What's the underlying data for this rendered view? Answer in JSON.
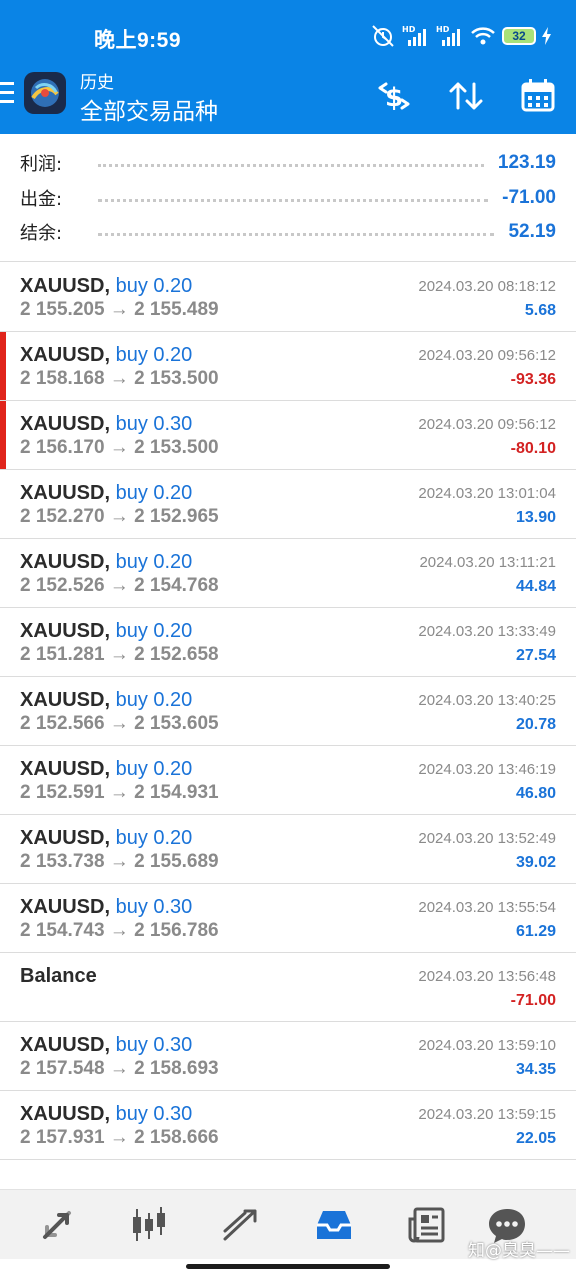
{
  "status_bar": {
    "time": "晚上9:59",
    "battery": "32"
  },
  "app_bar": {
    "title": "历史",
    "subtitle": "全部交易品种"
  },
  "summary": {
    "profit_label": "利润:",
    "profit_value": "123.19",
    "withdrawal_label": "出金:",
    "withdrawal_value": "-71.00",
    "balance_label": "结余:",
    "balance_value": "52.19"
  },
  "trades": [
    {
      "symbol": "XAUUSD,",
      "side": "buy 0.20",
      "prices": "2 155.205 → 2 155.489",
      "datetime": "2024.03.20 08:18:12",
      "profit": "5.68",
      "negative": false
    },
    {
      "symbol": "XAUUSD,",
      "side": "buy 0.20",
      "prices": "2 158.168 → 2 153.500",
      "datetime": "2024.03.20 09:56:12",
      "profit": "-93.36",
      "negative": true
    },
    {
      "symbol": "XAUUSD,",
      "side": "buy 0.30",
      "prices": "2 156.170 → 2 153.500",
      "datetime": "2024.03.20 09:56:12",
      "profit": "-80.10",
      "negative": true
    },
    {
      "symbol": "XAUUSD,",
      "side": "buy 0.20",
      "prices": "2 152.270 → 2 152.965",
      "datetime": "2024.03.20 13:01:04",
      "profit": "13.90",
      "negative": false
    },
    {
      "symbol": "XAUUSD,",
      "side": "buy 0.20",
      "prices": "2 152.526 → 2 154.768",
      "datetime": "2024.03.20 13:11:21",
      "profit": "44.84",
      "negative": false
    },
    {
      "symbol": "XAUUSD,",
      "side": "buy 0.20",
      "prices": "2 151.281 → 2 152.658",
      "datetime": "2024.03.20 13:33:49",
      "profit": "27.54",
      "negative": false
    },
    {
      "symbol": "XAUUSD,",
      "side": "buy 0.20",
      "prices": "2 152.566 → 2 153.605",
      "datetime": "2024.03.20 13:40:25",
      "profit": "20.78",
      "negative": false
    },
    {
      "symbol": "XAUUSD,",
      "side": "buy 0.20",
      "prices": "2 152.591 → 2 154.931",
      "datetime": "2024.03.20 13:46:19",
      "profit": "46.80",
      "negative": false
    },
    {
      "symbol": "XAUUSD,",
      "side": "buy 0.20",
      "prices": "2 153.738 → 2 155.689",
      "datetime": "2024.03.20 13:52:49",
      "profit": "39.02",
      "negative": false
    },
    {
      "symbol": "XAUUSD,",
      "side": "buy 0.30",
      "prices": "2 154.743 → 2 156.786",
      "datetime": "2024.03.20 13:55:54",
      "profit": "61.29",
      "negative": false
    },
    {
      "symbol": "Balance",
      "side": "",
      "prices": "",
      "datetime": "2024.03.20 13:56:48",
      "profit": "-71.00",
      "negative": true
    },
    {
      "symbol": "XAUUSD,",
      "side": "buy 0.30",
      "prices": "2 157.548 → 2 158.693",
      "datetime": "2024.03.20 13:59:10",
      "profit": "34.35",
      "negative": false
    },
    {
      "symbol": "XAUUSD,",
      "side": "buy 0.30",
      "prices": "2 157.931 → 2 158.666",
      "datetime": "2024.03.20 13:59:15",
      "profit": "22.05",
      "negative": false
    }
  ],
  "bottom_nav": [
    "quotes-icon",
    "chart-icon",
    "trade-icon",
    "history-icon",
    "news-icon",
    "chat-icon"
  ],
  "watermark": "知@臭臭——",
  "colors": {
    "brand": "#0a84e6",
    "positive": "#1a73d8",
    "negative": "#d32222",
    "marker": "#e0241b"
  }
}
